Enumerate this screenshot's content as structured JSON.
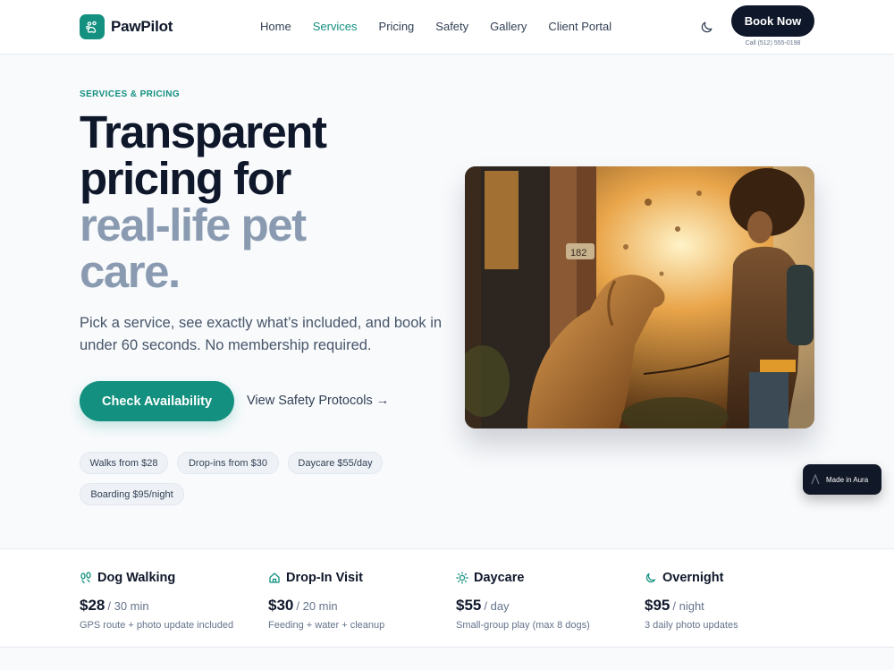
{
  "colors": {
    "accent": "#13907f",
    "dark": "#0f172a",
    "muted_title": "#8a9bb1"
  },
  "header": {
    "brand": "PawPilot",
    "nav": [
      "Home",
      "Services",
      "Pricing",
      "Safety",
      "Gallery",
      "Client Portal"
    ],
    "active_nav": "Services",
    "theme_icon": "moon-icon",
    "book_label": "Book Now",
    "phone": "Call (512) 555-0198"
  },
  "hero": {
    "eyebrow": "SERVICES & PRICING",
    "title_line1": "Transparent",
    "title_line2": "pricing for",
    "title_line3": "real-life pet",
    "title_line4": "care.",
    "lede": "Pick a service, see exactly what’s included, and book in under 60 seconds. No membership required.",
    "cta": "Check Availability",
    "link": "View Safety Protocols →",
    "chips": [
      "Walks from $28",
      "Drop-ins from $30",
      "Daycare $55/day",
      "Boarding $95/night"
    ]
  },
  "badge": {
    "label": "Made in Aura"
  },
  "services": [
    {
      "name": "Dog Walking",
      "icon": "paw-prints-icon",
      "price": "$28",
      "unit": "/ 30 min",
      "desc": "GPS route + photo update included"
    },
    {
      "name": "Drop-In Visit",
      "icon": "home-icon",
      "price": "$30",
      "unit": "/ 20 min",
      "desc": "Feeding + water + cleanup"
    },
    {
      "name": "Daycare",
      "icon": "sun-icon",
      "price": "$55",
      "unit": "/ day",
      "desc": "Small-group play (max 8 dogs)"
    },
    {
      "name": "Overnight",
      "icon": "moon-icon",
      "price": "$95",
      "unit": "/ night",
      "desc": "3 daily photo updates"
    }
  ]
}
